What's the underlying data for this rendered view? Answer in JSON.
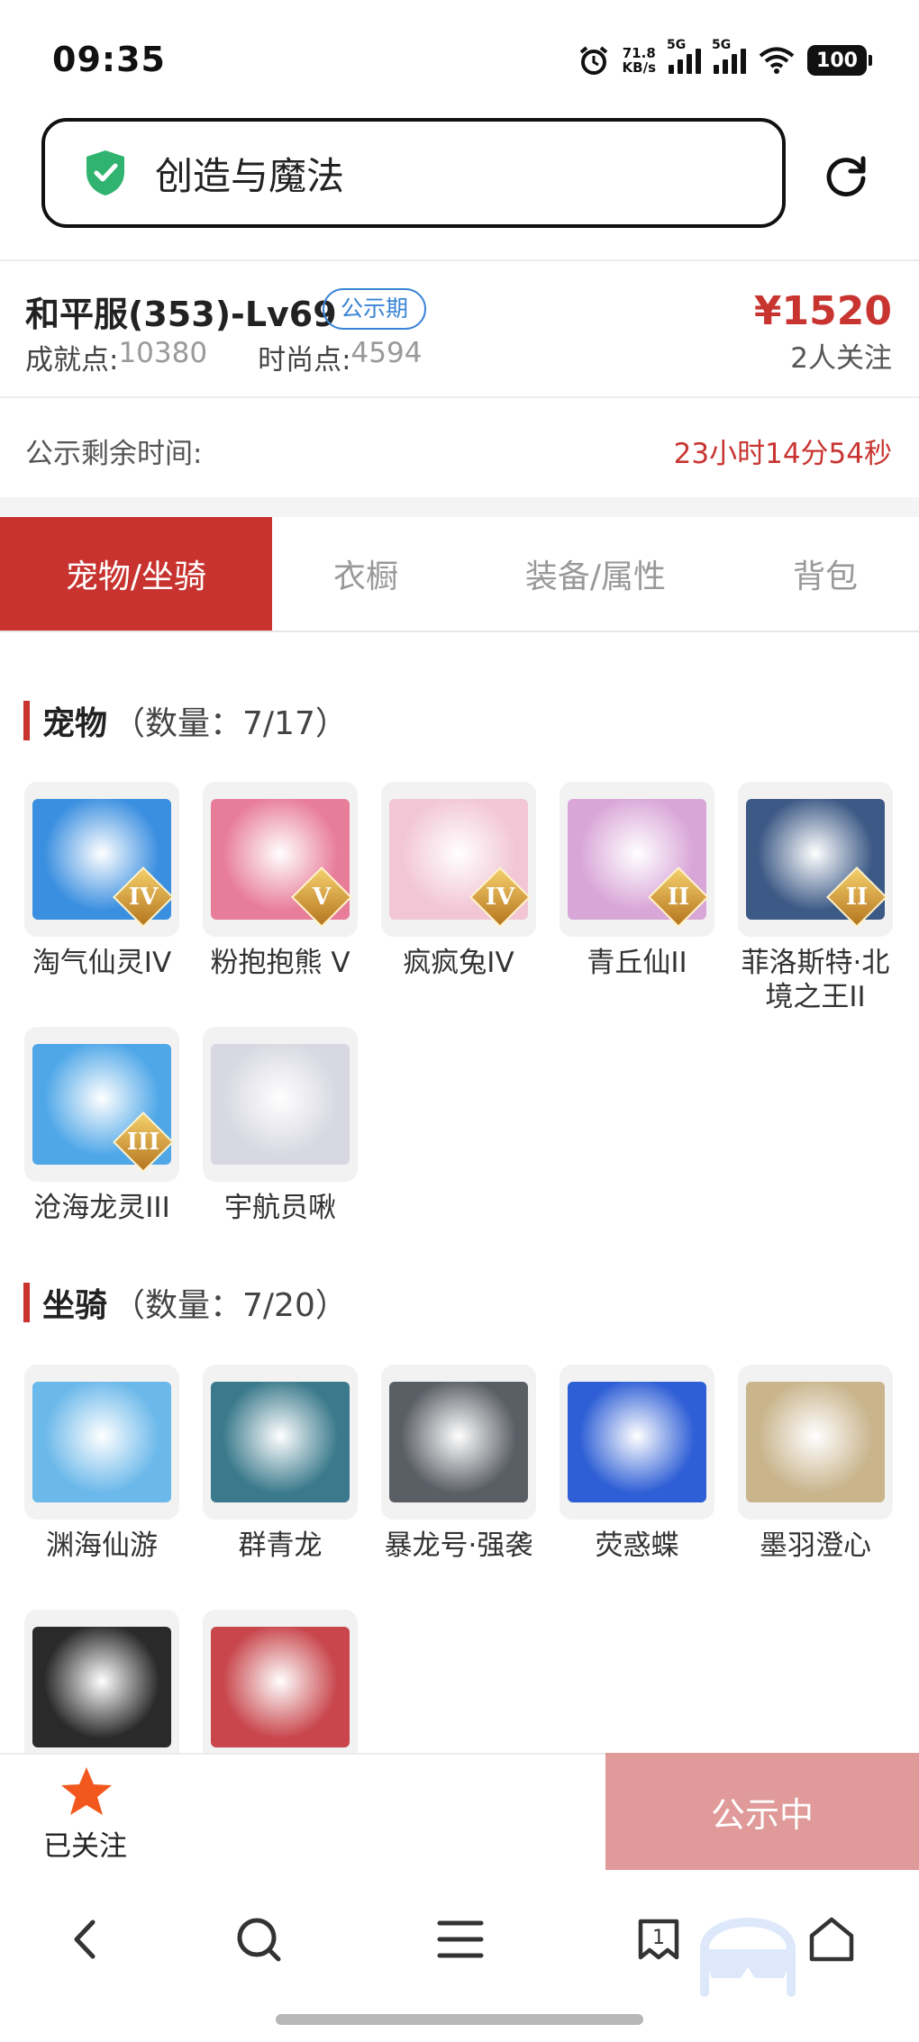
{
  "status_bar": {
    "time": "09:35",
    "net_speed_value": "71.8",
    "net_speed_unit": "KB/s",
    "sig1": "5G",
    "sig2": "5G",
    "battery": "100"
  },
  "url_bar": {
    "title": "创造与魔法"
  },
  "listing": {
    "server_level": "和平服(353)-Lv69",
    "tag": "公示期",
    "price": "¥1520",
    "followers": "2人关注",
    "achievement_label": "成就点:",
    "achievement_value": "10380",
    "fashion_label": "时尚点:",
    "fashion_value": "4594",
    "remaining_label": "公示剩余时间:",
    "remaining_value": "23小时14分54秒"
  },
  "tabs": [
    "宠物/坐骑",
    "衣橱",
    "装备/属性",
    "背包"
  ],
  "pets": {
    "title": "宠物",
    "count": "（数量：7/17）",
    "items": [
      {
        "name": "淘气仙灵IV",
        "badge": "IV",
        "color": "#3b8fe0"
      },
      {
        "name": "粉抱抱熊 V",
        "badge": "V",
        "color": "#e87d9a"
      },
      {
        "name": "疯疯兔IV",
        "badge": "IV",
        "color": "#f2c6d4"
      },
      {
        "name": "青丘仙II",
        "badge": "II",
        "color": "#d9a6d8"
      },
      {
        "name": "菲洛斯特·北境之王II",
        "badge": "II",
        "color": "#3d5a86"
      },
      {
        "name": "沧海龙灵III",
        "badge": "III",
        "color": "#4fa7e8"
      },
      {
        "name": "宇航员啾",
        "badge": "",
        "color": "#d8d8e2"
      }
    ]
  },
  "mounts": {
    "title": "坐骑",
    "count": "（数量：7/20）",
    "items": [
      {
        "name": "渊海仙游",
        "color": "#6bb8ea"
      },
      {
        "name": "群青龙",
        "color": "#3b7a8c"
      },
      {
        "name": "暴龙号·强袭",
        "color": "#5a5f66"
      },
      {
        "name": "荧惑蝶",
        "color": "#2f5fd6"
      },
      {
        "name": "墨羽澄心",
        "color": "#c9b48c"
      },
      {
        "name": "",
        "color": "#2a2a2a"
      },
      {
        "name": "",
        "color": "#c8464c"
      }
    ]
  },
  "action_bar": {
    "follow_label": "已关注",
    "status_button": "公示中"
  },
  "nav": {
    "tabs_count": "1"
  },
  "colors": {
    "accent": "#c8332f",
    "price": "#c83531",
    "tag": "#3a84d6",
    "disabled_btn": "#e09a99"
  }
}
